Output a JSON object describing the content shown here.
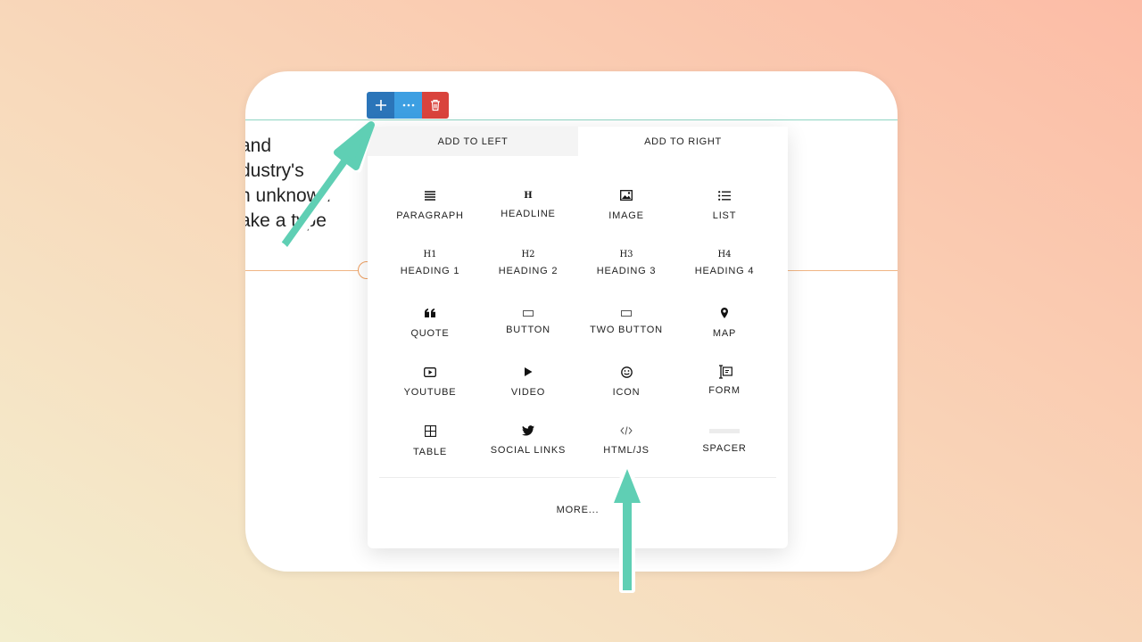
{
  "colors": {
    "add_button": "#2b75b9",
    "more_button": "#3d9fe2",
    "delete_button": "#d9433c",
    "annotation_arrow": "#5fcfb4",
    "row_line_top": "#8fd5c3",
    "row_line_mid": "#f0b584"
  },
  "background_text": [
    "and",
    "dustry's",
    "n unknown",
    "ake a type"
  ],
  "toolbar": {
    "add_icon": "plus-icon",
    "more_icon": "ellipsis-icon",
    "delete_icon": "trash-icon"
  },
  "panel": {
    "tabs": [
      "ADD TO LEFT",
      "ADD TO RIGHT"
    ],
    "active_tab": "ADD TO RIGHT",
    "items": [
      {
        "label": "PARAGRAPH",
        "icon": "paragraph-icon"
      },
      {
        "label": "HEADLINE",
        "icon": "headline-icon",
        "glyph": "H"
      },
      {
        "label": "IMAGE",
        "icon": "image-icon"
      },
      {
        "label": "LIST",
        "icon": "list-icon"
      },
      {
        "label": "HEADING 1",
        "icon": "heading1-icon",
        "glyph": "H1"
      },
      {
        "label": "HEADING 2",
        "icon": "heading2-icon",
        "glyph": "H2"
      },
      {
        "label": "HEADING 3",
        "icon": "heading3-icon",
        "glyph": "H3"
      },
      {
        "label": "HEADING 4",
        "icon": "heading4-icon",
        "glyph": "H4"
      },
      {
        "label": "QUOTE",
        "icon": "quote-icon"
      },
      {
        "label": "BUTTON",
        "icon": "button-icon"
      },
      {
        "label": "TWO BUTTON",
        "icon": "two-button-icon"
      },
      {
        "label": "MAP",
        "icon": "map-pin-icon"
      },
      {
        "label": "YOUTUBE",
        "icon": "youtube-icon"
      },
      {
        "label": "VIDEO",
        "icon": "play-icon"
      },
      {
        "label": "ICON",
        "icon": "smiley-icon"
      },
      {
        "label": "FORM",
        "icon": "form-icon"
      },
      {
        "label": "TABLE",
        "icon": "table-icon"
      },
      {
        "label": "SOCIAL LINKS",
        "icon": "twitter-icon"
      },
      {
        "label": "HTML/JS",
        "icon": "code-icon"
      },
      {
        "label": "SPACER",
        "icon": "spacer-icon"
      }
    ],
    "more_label": "MORE..."
  }
}
